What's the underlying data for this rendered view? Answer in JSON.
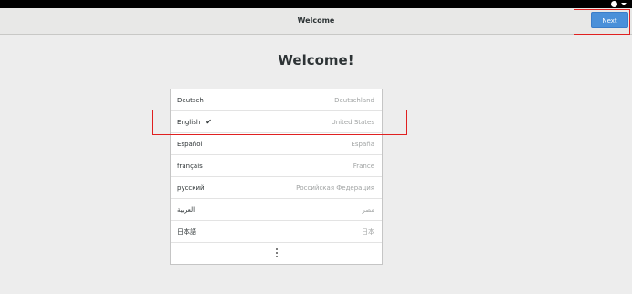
{
  "header": {
    "title": "Welcome",
    "next_label": "Next"
  },
  "main": {
    "heading": "Welcome!"
  },
  "languages": [
    {
      "name": "Deutsch",
      "region": "Deutschland",
      "selected": false
    },
    {
      "name": "English",
      "region": "United States",
      "selected": true
    },
    {
      "name": "Español",
      "region": "España",
      "selected": false
    },
    {
      "name": "français",
      "region": "France",
      "selected": false
    },
    {
      "name": "русский",
      "region": "Российская Федерация",
      "selected": false
    },
    {
      "name": "العربية",
      "region": "مصر",
      "selected": false
    },
    {
      "name": "日本語",
      "region": "日本",
      "selected": false
    }
  ],
  "icons": {
    "check": "✔",
    "accessibility": "accessibility-icon",
    "system_menu": "chevron-down-icon",
    "more": "more-vertical-icon"
  },
  "colors": {
    "accent": "#4a90d9",
    "highlight": "#e02020"
  }
}
